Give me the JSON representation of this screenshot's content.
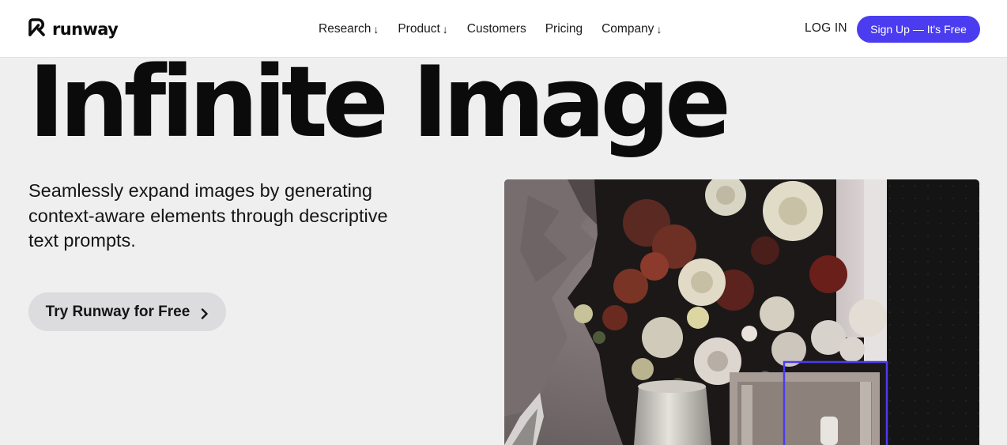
{
  "brand": {
    "name": "runway"
  },
  "nav": {
    "items": [
      {
        "label": "Research",
        "dropdown": true
      },
      {
        "label": "Product",
        "dropdown": true
      },
      {
        "label": "Customers",
        "dropdown": false
      },
      {
        "label": "Pricing",
        "dropdown": false
      },
      {
        "label": "Company",
        "dropdown": true
      }
    ],
    "dropdown_glyph": "↓"
  },
  "auth": {
    "login_label": "LOG IN",
    "signup_label": "Sign Up — It's Free"
  },
  "hero": {
    "title": "Infinite Image",
    "description": "Seamlessly expand images by generating context-aware elements through descriptive text prompts.",
    "cta_label": "Try Runway for Free"
  },
  "icons": {
    "logo": "runway-logo-icon",
    "cta_chevron": "chevron-right-icon",
    "nav_dropdown": "arrow-down-icon"
  },
  "colors": {
    "accent": "#4b3cf0",
    "page_background": "#efefef",
    "header_background": "#ffffff",
    "cta_background": "#dcdcde",
    "selection_box": "#4b3cf0"
  }
}
